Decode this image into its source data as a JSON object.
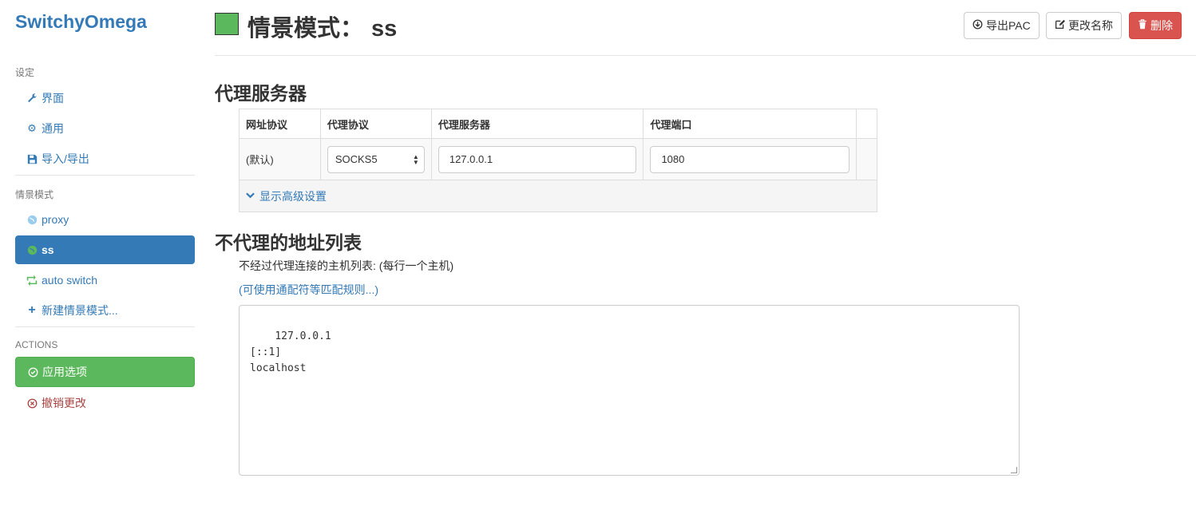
{
  "sidebar": {
    "brand": "SwitchyOmega",
    "settings_header": "设定",
    "settings_items": [
      {
        "label": "界面",
        "icon": "wrench-icon"
      },
      {
        "label": "通用",
        "icon": "gear-icon"
      },
      {
        "label": "导入/导出",
        "icon": "floppy-icon"
      }
    ],
    "profiles_header": "情景模式",
    "profiles": [
      {
        "label": "proxy",
        "icon": "globe-icon",
        "color": "#99ccee"
      },
      {
        "label": "ss",
        "icon": "globe-icon",
        "color": "#5cb85c",
        "active": true
      },
      {
        "label": "auto switch",
        "icon": "retweet-icon",
        "color": "#5cb85c"
      }
    ],
    "new_profile": "新建情景模式...",
    "actions_header": "ACTIONS",
    "apply": "应用选项",
    "discard": "撤销更改"
  },
  "header": {
    "title_prefix": "情景模式：",
    "profile_name": "ss",
    "profile_color": "#5cb85c",
    "export_pac": "导出PAC",
    "rename": "更改名称",
    "delete": "删除"
  },
  "proxy_section": {
    "title": "代理服务器",
    "columns": [
      "网址协议",
      "代理协议",
      "代理服务器",
      "代理端口"
    ],
    "row": {
      "scheme": "(默认)",
      "protocol": "SOCKS5",
      "server": "127.0.0.1",
      "port": "1080"
    },
    "advanced": "显示高级设置"
  },
  "bypass_section": {
    "title": "不代理的地址列表",
    "help": "不经过代理连接的主机列表: (每行一个主机)",
    "wildcard_link": "(可使用通配符等匹配规则...)",
    "list": "127.0.0.1\n[::1]\nlocalhost"
  },
  "colors": {
    "primary": "#337ab7",
    "success": "#5cb85c",
    "danger": "#d9534f"
  }
}
